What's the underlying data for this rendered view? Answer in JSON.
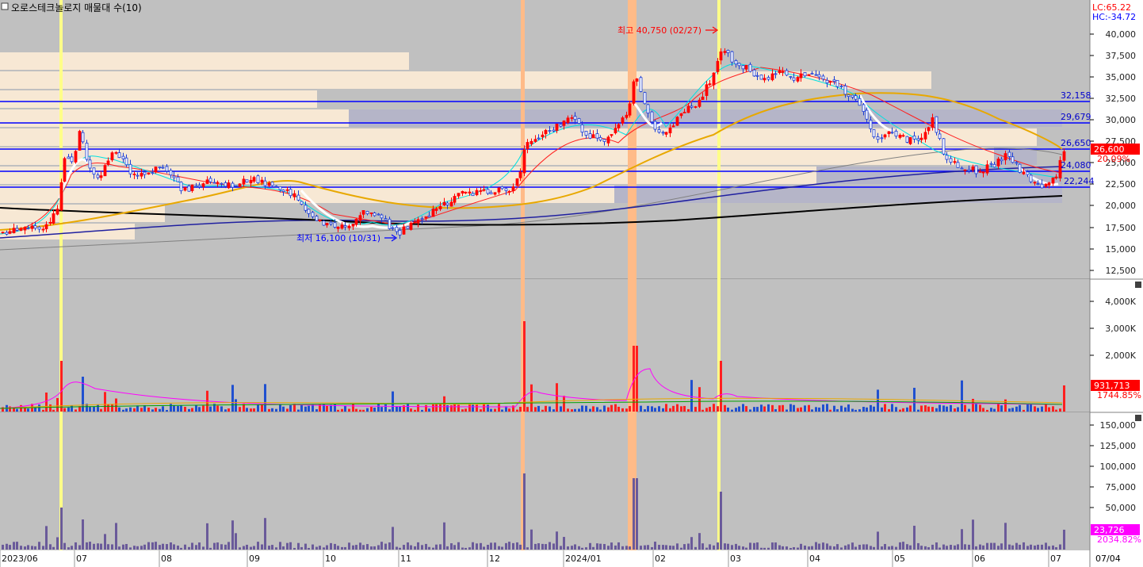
{
  "header": {
    "title": "오로스테크놀로지 매물대 수(10)",
    "lc": "LC:65.22",
    "hc": "HC:-34.72"
  },
  "price_axis": {
    "ticks": [
      "40,000",
      "37,500",
      "35,000",
      "32,500",
      "30,000",
      "27,500",
      "25,000",
      "22,500",
      "20,000",
      "17,500",
      "15,000",
      "12,500"
    ],
    "current_price": "26,600",
    "current_change": "20.09%"
  },
  "volume_axis": {
    "ticks": [
      "4,000K",
      "3,000K",
      "2,000K"
    ],
    "current_value": "931,713",
    "current_pct": "1744.85%"
  },
  "amount_axis": {
    "ticks": [
      "150,000",
      "125,000",
      "100,000",
      "75,000",
      "50,000"
    ],
    "current_value": "23,726",
    "current_pct": "2034.82%"
  },
  "date_axis": {
    "labels": [
      "2023/06",
      "07",
      "08",
      "09",
      "10",
      "11",
      "12",
      "2024/01",
      "02",
      "03",
      "04",
      "05",
      "06",
      "07"
    ],
    "current_date": "07/04"
  },
  "annotations": {
    "high": "최고 40,750 (02/27)",
    "low": "최저 16,100 (10/31)"
  },
  "levels": {
    "values": [
      "32,158",
      "29,679",
      "26,650",
      "24,080",
      "22,244"
    ]
  },
  "colors": {
    "up": "#ff0000",
    "down": "#1a3cd6",
    "panel_bg": "#c0c0c0",
    "volume_profile": "#f7e8d4",
    "level_line": "#0000ff",
    "ma_yellow": "#e8a800",
    "ma_black": "#000000"
  },
  "chart_data": {
    "type": "candlestick",
    "title": "오로스테크놀로지 매물대 수(10)",
    "x_range": [
      "2023/06",
      "07/04"
    ],
    "ylim": [
      12500,
      40000
    ],
    "high": {
      "value": 40750,
      "date": "02/27"
    },
    "low": {
      "value": 16100,
      "date": "10/31"
    },
    "current_price": 26600,
    "current_change_pct": 20.09,
    "resistance_levels": [
      32158,
      29679,
      26650,
      24080,
      22244
    ],
    "volume": {
      "ylim": [
        0,
        4000000
      ],
      "current": 931713,
      "pct": 1744.85
    },
    "amount": {
      "ylim": [
        0,
        150000
      ],
      "current": 23726,
      "pct": 2034.82
    }
  }
}
